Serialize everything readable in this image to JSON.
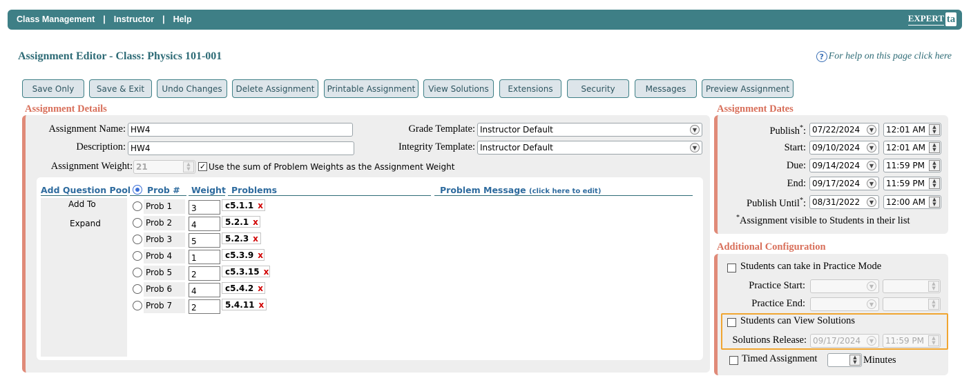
{
  "nav": {
    "items": [
      "Class Management",
      "Instructor",
      "Help"
    ],
    "separator": "|",
    "logo_text": "EXPERT",
    "logo_mark": "ta"
  },
  "page": {
    "title": "Assignment Editor - Class: Physics 101-001",
    "help_text": "For help on this page click here"
  },
  "toolbar": [
    "Save Only",
    "Save & Exit",
    "Undo Changes",
    "Delete Assignment",
    "Printable Assignment",
    "View Solutions",
    "Extensions",
    "Security",
    "Messages",
    "Preview Assignment"
  ],
  "details": {
    "section_title": "Assignment Details",
    "name_label": "Assignment Name:",
    "name_value": "HW4",
    "desc_label": "Description:",
    "desc_value": "HW4",
    "weight_label": "Assignment Weight:",
    "weight_value": "21",
    "use_sum_label": "Use the sum of Problem Weights as the Assignment Weight",
    "use_sum_checked": true,
    "grade_template_label": "Grade Template:",
    "grade_template_value": "Instructor Default",
    "integrity_template_label": "Integrity Template:",
    "integrity_template_value": "Instructor Default"
  },
  "questions": {
    "pool_header": "Add Question Pool",
    "pool_items": [
      "Add To",
      "Expand"
    ],
    "col_prob": "Prob #",
    "col_weight": "Weight",
    "col_problems": "Problems",
    "col_message": "Problem Message",
    "col_message_hint": "(click here to edit)",
    "remove_glyph": "x",
    "rows": [
      {
        "prob": "Prob 1",
        "weight": "3",
        "problem": "c5.1.1"
      },
      {
        "prob": "Prob 2",
        "weight": "4",
        "problem": "5.2.1"
      },
      {
        "prob": "Prob 3",
        "weight": "5",
        "problem": "5.2.3"
      },
      {
        "prob": "Prob 4",
        "weight": "1",
        "problem": "c5.3.9"
      },
      {
        "prob": "Prob 5",
        "weight": "2",
        "problem": "c5.3.15"
      },
      {
        "prob": "Prob 6",
        "weight": "4",
        "problem": "c5.4.2"
      },
      {
        "prob": "Prob 7",
        "weight": "2",
        "problem": "5.4.11"
      }
    ]
  },
  "dates": {
    "section_title": "Assignment Dates",
    "rows": [
      {
        "label": "Publish",
        "star": "*",
        "date": "07/22/2024",
        "time": "12:01 AM"
      },
      {
        "label": "Start:",
        "star": "",
        "date": "09/10/2024",
        "time": "12:01 AM"
      },
      {
        "label": "Due:",
        "star": "",
        "date": "09/14/2024",
        "time": "11:59 PM"
      },
      {
        "label": "End:",
        "star": "",
        "date": "09/17/2024",
        "time": "11:59 PM"
      },
      {
        "label": "Publish Until",
        "star": "*",
        "date": "08/31/2022",
        "time": "12:00 AM"
      }
    ],
    "colon": ":",
    "footnote_star": "*",
    "footnote": "Assignment visible to Students in their list"
  },
  "config": {
    "section_title": "Additional Configuration",
    "practice_mode_label": "Students can take in Practice Mode",
    "practice_start_label": "Practice Start:",
    "practice_end_label": "Practice End:",
    "view_solutions_label": "Students can View Solutions",
    "solutions_release_label": "Solutions Release:",
    "solutions_release_date": "09/17/2024",
    "solutions_release_time": "11:59 PM",
    "timed_label": "Timed Assignment",
    "minutes_label": "Minutes"
  },
  "colors": {
    "nav_bg": "#3e7f86",
    "section_title": "#d86f5a",
    "panel_border": "#e08a78",
    "link_blue": "#2e6b9e",
    "highlight": "#f0a530",
    "remove_red": "#d00000"
  }
}
